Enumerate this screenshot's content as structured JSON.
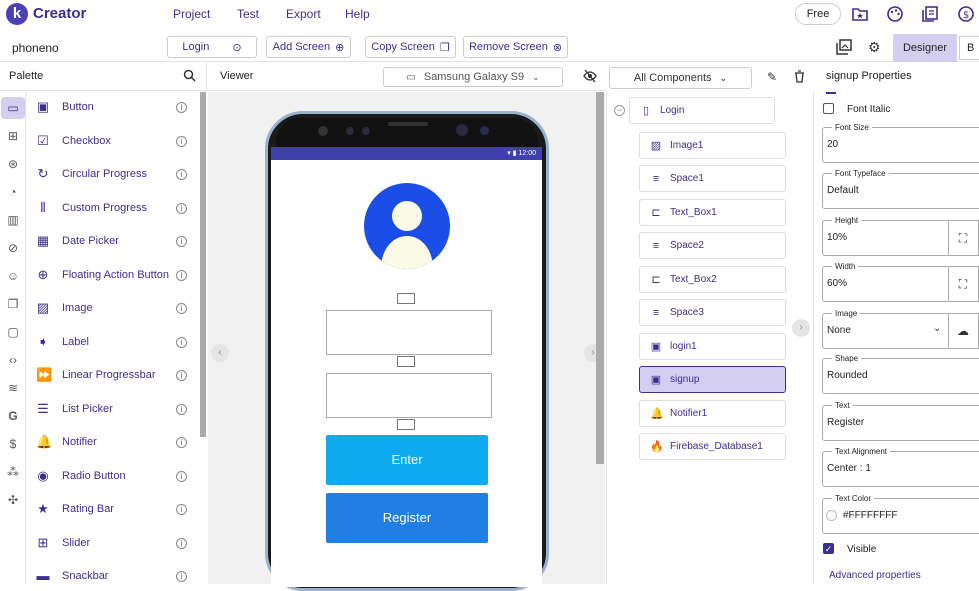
{
  "app": {
    "name": "Creator",
    "logo_letter": "k"
  },
  "menu": {
    "project": "Project",
    "test": "Test",
    "export": "Export",
    "help": "Help"
  },
  "top_actions": {
    "free": "Free"
  },
  "toolbar": {
    "project_name": "phoneno",
    "screen_select": "Login",
    "add_screen": "Add Screen",
    "copy_screen": "Copy Screen",
    "remove_screen": "Remove Screen",
    "designer": "Designer",
    "blocks": "B"
  },
  "palette": {
    "title": "Palette",
    "items": [
      {
        "label": "Button",
        "icon": "▣"
      },
      {
        "label": "Checkbox",
        "icon": "☑"
      },
      {
        "label": "Circular Progress",
        "icon": "↻"
      },
      {
        "label": "Custom Progress",
        "icon": "⫴"
      },
      {
        "label": "Date Picker",
        "icon": "▦"
      },
      {
        "label": "Floating Action Button",
        "icon": "⊕"
      },
      {
        "label": "Image",
        "icon": "▨"
      },
      {
        "label": "Label",
        "icon": "➧"
      },
      {
        "label": "Linear Progressbar",
        "icon": "⏩"
      },
      {
        "label": "List Picker",
        "icon": "☰"
      },
      {
        "label": "Notifier",
        "icon": "🔔"
      },
      {
        "label": "Radio Button",
        "icon": "◉"
      },
      {
        "label": "Rating Bar",
        "icon": "★"
      },
      {
        "label": "Slider",
        "icon": "⊞"
      },
      {
        "label": "Snackbar",
        "icon": "▬"
      }
    ]
  },
  "viewer": {
    "title": "Viewer",
    "device": "Samsung Galaxy S9",
    "status_time": "▾ ▮ 12:00",
    "enter_label": "Enter",
    "register_label": "Register"
  },
  "components": {
    "selector": "All Components",
    "root": {
      "label": "Login",
      "icon": "▯"
    },
    "children": [
      {
        "label": "Image1",
        "icon": "▨"
      },
      {
        "label": "Space1",
        "icon": "≡"
      },
      {
        "label": "Text_Box1",
        "icon": "⊏"
      },
      {
        "label": "Space2",
        "icon": "≡"
      },
      {
        "label": "Text_Box2",
        "icon": "⊏"
      },
      {
        "label": "Space3",
        "icon": "≡"
      },
      {
        "label": "login1",
        "icon": "▣"
      },
      {
        "label": "signup",
        "icon": "▣"
      },
      {
        "label": "Notifier1",
        "icon": "🔔"
      },
      {
        "label": "Firebase_Database1",
        "icon": "🔥"
      }
    ]
  },
  "properties": {
    "title": "signup Properties",
    "font_italic": "Font Italic",
    "font_size_label": "Font Size",
    "font_size": "20",
    "font_typeface_label": "Font Typeface",
    "font_typeface": "Default",
    "height_label": "Height",
    "height": "10%",
    "width_label": "Width",
    "width": "60%",
    "image_label": "Image",
    "image": "None",
    "shape_label": "Shape",
    "shape": "Rounded",
    "text_label": "Text",
    "text": "Register",
    "text_alignment_label": "Text Alignment",
    "text_alignment": "Center : 1",
    "text_color_label": "Text Color",
    "text_color": "#FFFFFFFF",
    "visible": "Visible",
    "advanced": "Advanced properties"
  },
  "colors": {
    "accent": "#3b2f8f",
    "selected": "#d4cff0",
    "enter_button": "#0daaf0",
    "register_button": "#1f7fe2",
    "status_bar": "#3f3fb0"
  }
}
